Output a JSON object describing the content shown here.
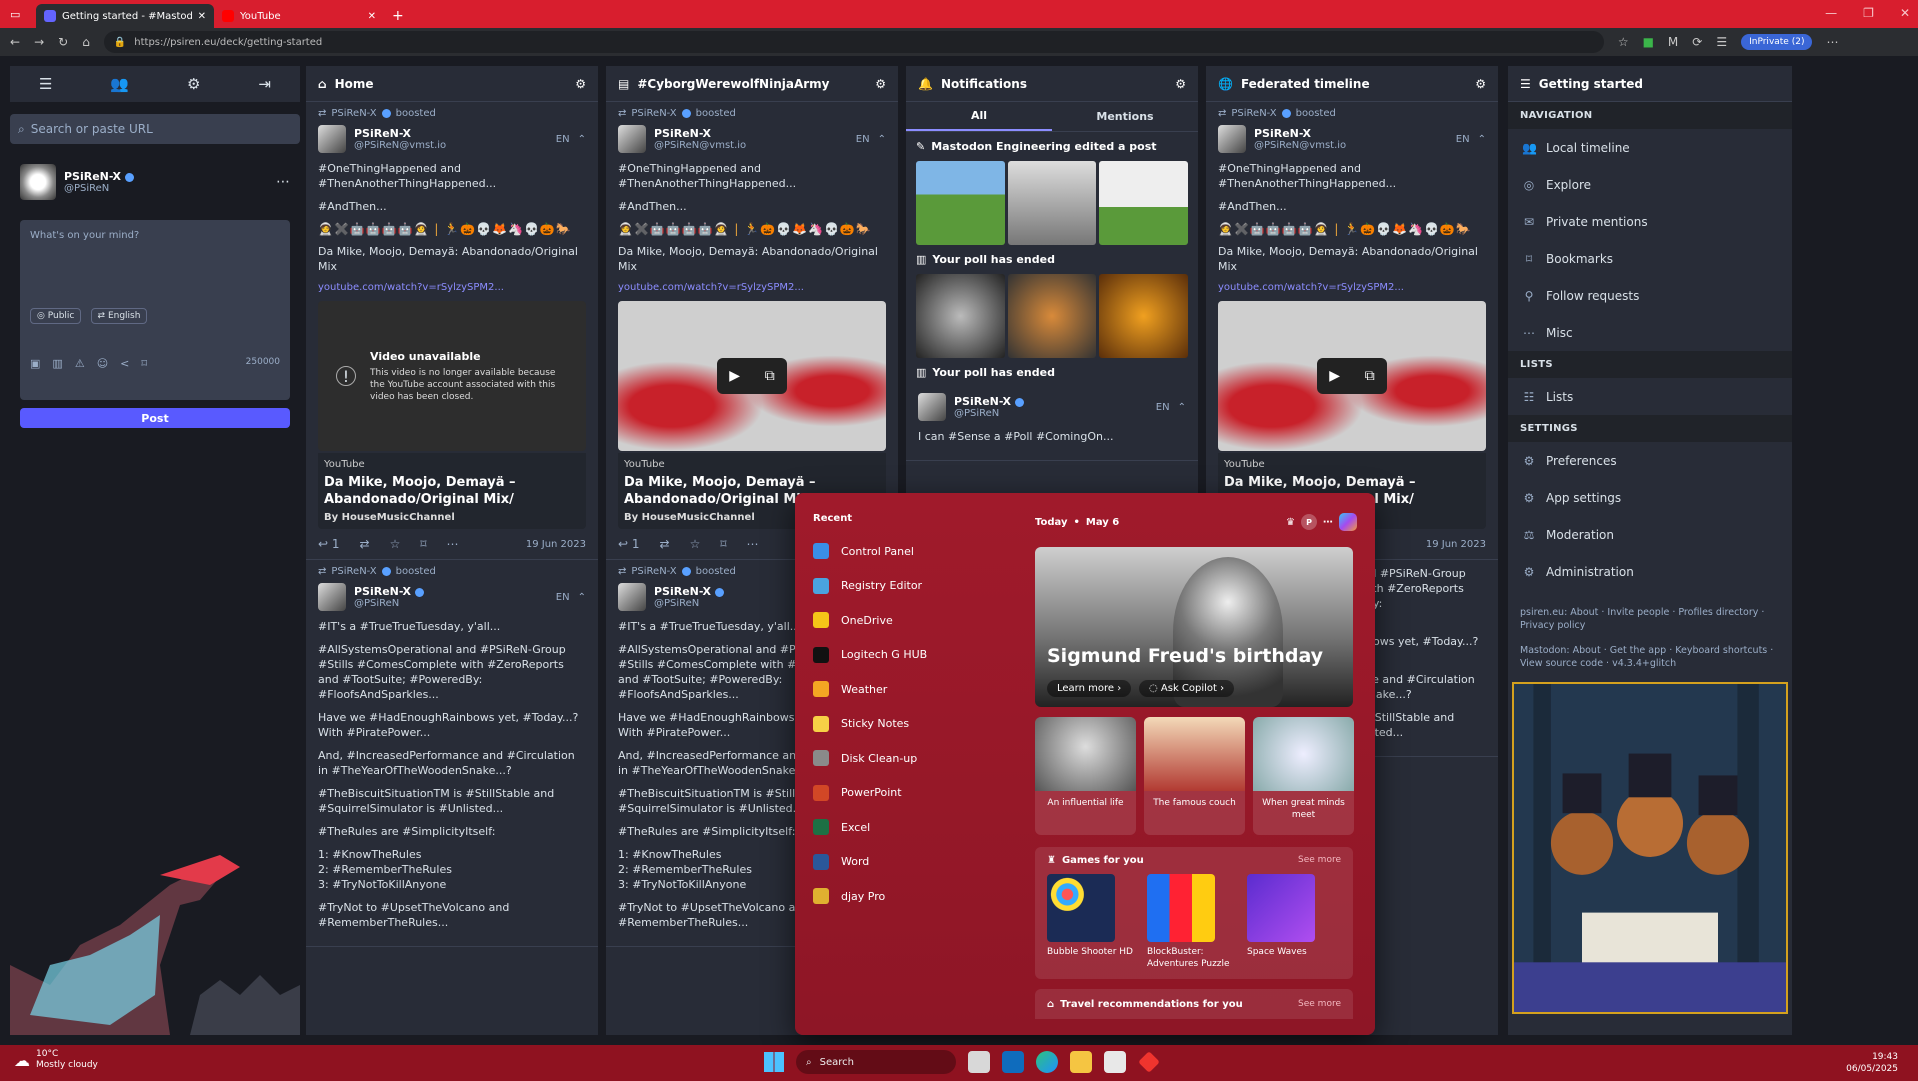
{
  "browser": {
    "tabs": [
      {
        "title": "Getting started - #MastodonSpy",
        "active": true
      },
      {
        "title": "YouTube",
        "active": false
      }
    ],
    "url": "https://psiren.eu/deck/getting-started",
    "inprivate": "InPrivate (2)"
  },
  "compose": {
    "search_placeholder": "Search or paste URL",
    "user": {
      "name": "PSiReN-X",
      "handle": "@PSiReN"
    },
    "placeholder": "What's on your mind?",
    "visibility": "Public",
    "language": "English",
    "char_count": "250000",
    "post_label": "Post"
  },
  "columns": [
    {
      "title": "Home",
      "icon": "home-icon",
      "posts": [
        {
          "booster": "PSiReN-X",
          "boosted_label": "boosted",
          "name": "PSiReN-X",
          "handle": "@PSiReN@vmst.io",
          "lang": "EN",
          "text1": "#OneThingHappened and #ThenAnotherThingHappened...",
          "text2": "#AndThen...",
          "emojis": "🧑‍🚀✖️🤖🤖🤖🤖🧑‍🚀 | 🏃🎃💀🦊🦄💀🎃🐎",
          "text3": "Da Mike, Moojo, Demayä: Abandonado/Original Mix",
          "link": "youtube.com/watch?v=rSylzySPM2...",
          "video_title": "Video unavailable",
          "video_desc": "This video is no longer available because the YouTube account associated with this video has been closed.",
          "provider": "YouTube",
          "card_title": "Da Mike, Moojo, Demayä – Abandonado/Original Mix/",
          "card_by": "By HouseMusicChannel",
          "replies": "1",
          "date": "19 Jun 2023"
        },
        {
          "booster": "PSiReN-X",
          "boosted_label": "boosted",
          "name": "PSiReN-X",
          "handle": "@PSiReN",
          "lang": "EN",
          "lines": [
            "#IT's a #TrueTrueTuesday, y'all...",
            "#AllSystemsOperational and #PSiReN-Group #Stills #ComesComplete with #ZeroReports and #TootSuite; #PoweredBy: #FloofsAndSparkles...",
            "Have we #HadEnoughRainbows yet, #Today...? With #PiratePower...",
            "And, #IncreasedPerformance and #Circulation in #TheYearOfTheWoodenSnake...?",
            "#TheBiscuitSituationTM is #StillStable and #SquirrelSimulator is #Unlisted...",
            "#TheRules are #SimplicityItself:",
            "1: #KnowTheRules\n2: #RememberTheRules\n3: #TryNotToKillAnyone",
            "#TryNot to #UpsetTheVolcano and #RememberTheRules..."
          ]
        }
      ]
    },
    {
      "title": "#CyborgWerewolfNinjaArmy",
      "icon": "hashtag-icon"
    },
    {
      "title": "Notifications",
      "icon": "bell-icon",
      "tabs": [
        "All",
        "Mentions"
      ],
      "items": [
        {
          "text": "Mastodon Engineering edited a post"
        },
        {
          "text": "Your poll has ended"
        },
        {
          "text": "Your poll has ended"
        }
      ],
      "post": {
        "name": "PSiReN-X",
        "handle": "@PSiReN",
        "lang": "EN",
        "text": "I can #Sense a #Poll #ComingOn..."
      }
    },
    {
      "title": "Federated timeline",
      "icon": "globe-icon"
    }
  ],
  "getting_started": {
    "title": "Getting started",
    "sections": [
      {
        "label": "NAVIGATION",
        "items": [
          {
            "label": "Local timeline",
            "icon": "users-icon"
          },
          {
            "label": "Explore",
            "icon": "compass-icon"
          },
          {
            "label": "Private mentions",
            "icon": "envelope-icon"
          },
          {
            "label": "Bookmarks",
            "icon": "bookmark-icon"
          },
          {
            "label": "Follow requests",
            "icon": "user-plus-icon"
          },
          {
            "label": "Misc",
            "icon": "ellipsis-icon"
          }
        ]
      },
      {
        "label": "LISTS",
        "items": [
          {
            "label": "Lists",
            "icon": "list-icon"
          }
        ]
      },
      {
        "label": "SETTINGS",
        "items": [
          {
            "label": "Preferences",
            "icon": "gear-icon"
          },
          {
            "label": "App settings",
            "icon": "gears-icon"
          },
          {
            "label": "Moderation",
            "icon": "gavel-icon"
          },
          {
            "label": "Administration",
            "icon": "gears-icon"
          }
        ]
      }
    ],
    "footer1": "psiren.eu: About · Invite people · Profiles directory · Privacy policy",
    "footer2": "Mastodon: About · Get the app · Keyboard shortcuts · View source code · v4.3.4+glitch"
  },
  "startmenu": {
    "recent_label": "Recent",
    "apps": [
      {
        "label": "Control Panel",
        "color": "#3a8ee6"
      },
      {
        "label": "Registry Editor",
        "color": "#4aa3df"
      },
      {
        "label": "OneDrive",
        "color": "#f5c518"
      },
      {
        "label": "Logitech G HUB",
        "color": "#111111"
      },
      {
        "label": "Weather",
        "color": "#f4a623"
      },
      {
        "label": "Sticky Notes",
        "color": "#f7d046"
      },
      {
        "label": "Disk Clean-up",
        "color": "#8a8a8a"
      },
      {
        "label": "PowerPoint",
        "color": "#d24726"
      },
      {
        "label": "Excel",
        "color": "#1d7044"
      },
      {
        "label": "Word",
        "color": "#2b579a"
      },
      {
        "label": "djay Pro",
        "color": "#e0b030"
      }
    ],
    "today": "Today",
    "date": "May 6",
    "hero_title": "Sigmund Freud's birthday",
    "learn_more": "Learn more",
    "ask_copilot": "Ask Copilot",
    "tiles": [
      "An influential life",
      "The famous couch",
      "When great minds meet"
    ],
    "games_label": "Games for you",
    "see_more": "See more",
    "games": [
      "Bubble Shooter HD",
      "BlockBuster: Adventures Puzzle",
      "Space Waves"
    ],
    "travel_label": "Travel recommendations for you"
  },
  "taskbar": {
    "temp": "10°C",
    "weather": "Mostly cloudy",
    "search": "Search",
    "time": "19:43",
    "date": "06/05/2025"
  }
}
